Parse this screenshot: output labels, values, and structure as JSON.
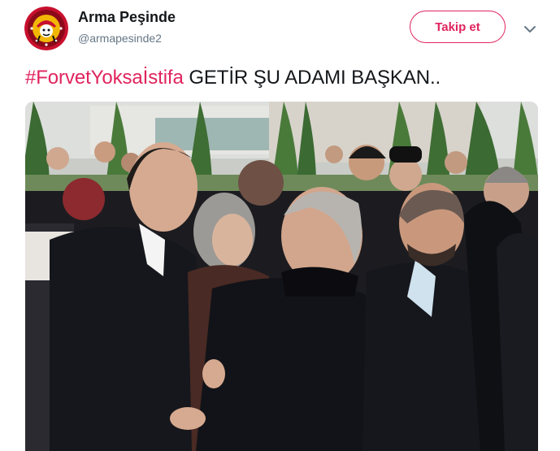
{
  "tweet": {
    "display_name": "Arma Peşinde",
    "handle": "@armapesinde2",
    "follow_label": "Takip et",
    "hashtag": "#ForvetYoksaİstifa",
    "text": " GETİR ŞU ADAMI BAŞKAN.."
  },
  "avatar": {
    "ring_text": "ARMA PEŞİNDE",
    "colors": {
      "outer": "#c8102e",
      "ring": "#8b0a1a",
      "inner": "#f2b705"
    }
  },
  "icons": {
    "caret": "chevron-down-icon"
  },
  "colors": {
    "accent": "#e0245e",
    "name_text": "#14171a",
    "secondary_text": "#657786"
  }
}
